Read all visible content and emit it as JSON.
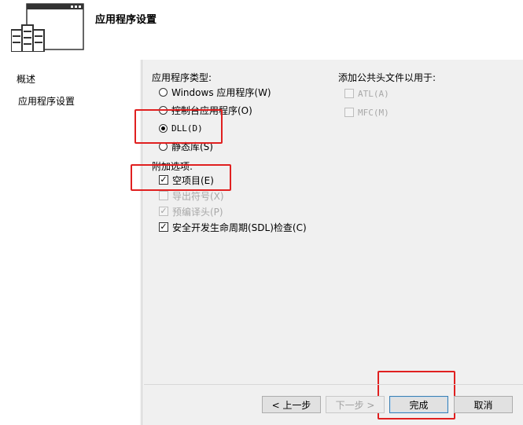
{
  "header": {
    "title": "应用程序设置"
  },
  "sidebar": {
    "items": [
      {
        "label": "概述"
      },
      {
        "label": "应用程序设置"
      }
    ]
  },
  "app_type": {
    "label": "应用程序类型:",
    "options": [
      {
        "label": "Windows 应用程序(W)",
        "checked": false
      },
      {
        "label": "控制台应用程序(O)",
        "checked": false
      },
      {
        "label": "DLL(D)",
        "checked": true
      },
      {
        "label": "静态库(S)",
        "checked": false
      }
    ]
  },
  "extra": {
    "label": "附加选项:",
    "options": [
      {
        "label": "空项目(E)",
        "checked": true,
        "enabled": true
      },
      {
        "label": "导出符号(X)",
        "checked": false,
        "enabled": false
      },
      {
        "label": "预编译头(P)",
        "checked": true,
        "enabled": false
      },
      {
        "label": "安全开发生命周期(SDL)检查(C)",
        "checked": true,
        "enabled": true
      }
    ]
  },
  "common_headers": {
    "label": "添加公共头文件以用于:",
    "options": [
      {
        "label": "ATL(A)",
        "checked": false,
        "enabled": false
      },
      {
        "label": "MFC(M)",
        "checked": false,
        "enabled": false
      }
    ]
  },
  "buttons": {
    "prev": "< 上一步",
    "next": "下一步 >",
    "finish": "完成",
    "cancel": "取消"
  },
  "colors": {
    "highlight_box": "#e02020",
    "accent": "#3c7fb1"
  }
}
